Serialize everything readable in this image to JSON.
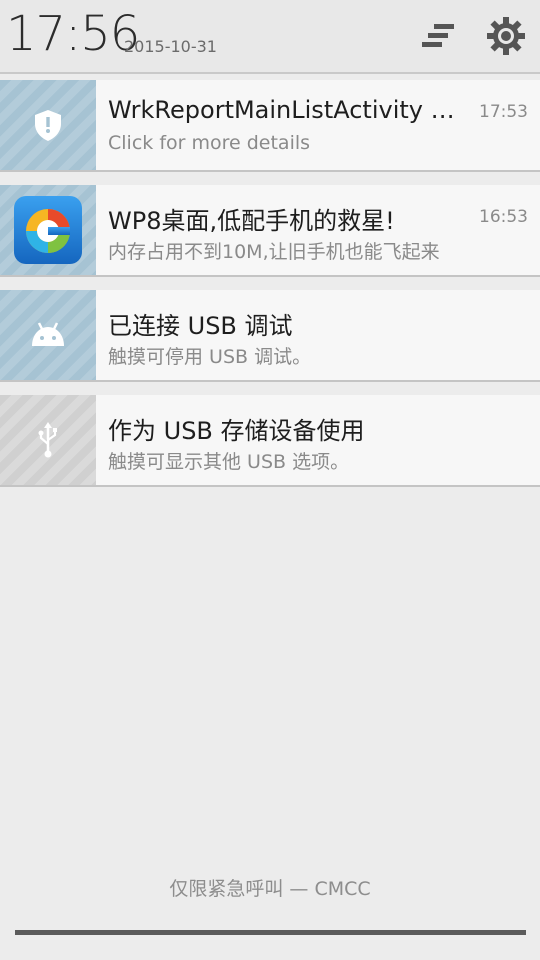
{
  "header": {
    "time": "17:56",
    "date": "2015-10-31",
    "clear_icon": "clear-all-icon",
    "settings_icon": "gear-icon"
  },
  "notifications": [
    {
      "icon": "shield-icon",
      "title": "WrkReportMainListActivity h...",
      "subtitle": "Click for more details",
      "time": "17:53"
    },
    {
      "icon": "app-launcher-icon",
      "title": "WP8桌面,低配手机的救星!",
      "subtitle": "内存占用不到10M,让旧手机也能飞起来",
      "time": "16:53"
    },
    {
      "icon": "android-icon",
      "title": "已连接 USB 调试",
      "subtitle": "触摸可停用 USB 调试。"
    },
    {
      "icon": "usb-icon",
      "title": "作为 USB 存储设备使用",
      "subtitle": "触摸可显示其他 USB 选项。"
    }
  ],
  "footer": {
    "carrier_text": "仅限紧急呼叫 — CMCC"
  },
  "colors": {
    "tile_blue": "#a6c3d3",
    "tile_gray": "#d0d0d0",
    "app_icon_blue": "#1d7fd6"
  }
}
